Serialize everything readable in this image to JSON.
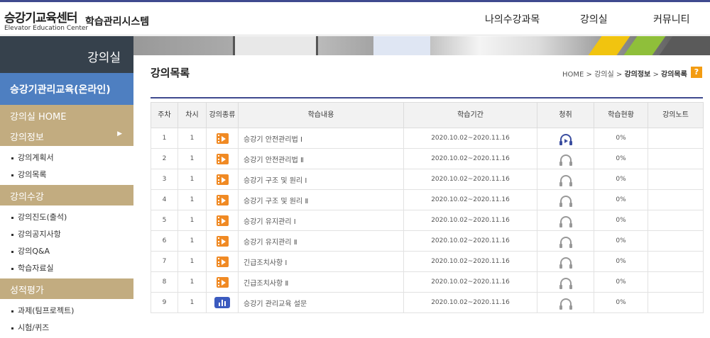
{
  "header": {
    "logo_main": "승강기교육센터",
    "logo_sub": "Elevator Education Center",
    "system_title": "학습관리시스템",
    "nav": [
      "나의수강과목",
      "강의실",
      "커뮤니티"
    ]
  },
  "sidebar": {
    "title": "강의실",
    "course": "승강기관리교육(온라인)",
    "home": "강의실 HOME",
    "sections": [
      {
        "label": "강의정보",
        "items": [
          "강의계획서",
          "강의목록"
        ]
      },
      {
        "label": "강의수강",
        "items": [
          "강의진도(출석)",
          "강의공지사항",
          "강의Q&A",
          "학습자료실"
        ]
      },
      {
        "label": "성적평가",
        "items": [
          "과제(팀프로젝트)",
          "시험/퀴즈"
        ]
      }
    ]
  },
  "page": {
    "title": "강의목록",
    "breadcrumb": [
      "HOME",
      "강의실",
      "강의정보",
      "강의목록"
    ],
    "help_label": "?"
  },
  "table": {
    "headers": [
      "주차",
      "차시",
      "강의종류",
      "학습내용",
      "학습기간",
      "청취",
      "학습현황",
      "강의노트"
    ],
    "rows": [
      {
        "week": "1",
        "session": "1",
        "type": "video-icon",
        "title": "승강기 안전관리법 Ⅰ",
        "period": "2020.10.02~2020.11.16",
        "listen": "active",
        "progress": "0%",
        "note": ""
      },
      {
        "week": "2",
        "session": "1",
        "type": "video-icon",
        "title": "승강기 안전관리법 Ⅱ",
        "period": "2020.10.02~2020.11.16",
        "listen": "inactive",
        "progress": "0%",
        "note": ""
      },
      {
        "week": "3",
        "session": "1",
        "type": "video-icon",
        "title": "승강기 구조 및 원리 Ⅰ",
        "period": "2020.10.02~2020.11.16",
        "listen": "inactive",
        "progress": "0%",
        "note": ""
      },
      {
        "week": "4",
        "session": "1",
        "type": "video-icon",
        "title": "승강기 구조 및 원리 Ⅱ",
        "period": "2020.10.02~2020.11.16",
        "listen": "inactive",
        "progress": "0%",
        "note": ""
      },
      {
        "week": "5",
        "session": "1",
        "type": "video-icon",
        "title": "승강기 유지관리 Ⅰ",
        "period": "2020.10.02~2020.11.16",
        "listen": "inactive",
        "progress": "0%",
        "note": ""
      },
      {
        "week": "6",
        "session": "1",
        "type": "video-icon",
        "title": "승강기 유지관리 Ⅱ",
        "period": "2020.10.02~2020.11.16",
        "listen": "inactive",
        "progress": "0%",
        "note": ""
      },
      {
        "week": "7",
        "session": "1",
        "type": "video-icon",
        "title": "긴급조치사항 Ⅰ",
        "period": "2020.10.02~2020.11.16",
        "listen": "inactive",
        "progress": "0%",
        "note": ""
      },
      {
        "week": "8",
        "session": "1",
        "type": "video-icon",
        "title": "긴급조치사항 Ⅱ",
        "period": "2020.10.02~2020.11.16",
        "listen": "inactive",
        "progress": "0%",
        "note": ""
      },
      {
        "week": "9",
        "session": "1",
        "type": "survey-icon",
        "title": "승강기 관리교육 설문",
        "period": "2020.10.02~2020.11.16",
        "listen": "inactive",
        "progress": "0%",
        "note": ""
      }
    ]
  },
  "colors": {
    "accent": "#3f4a8f",
    "sidebar_dark": "#36414c",
    "sidebar_course": "#4e7fc1",
    "sidebar_section": "#c2ac80",
    "video_icon": "#f08a24",
    "survey_icon": "#3b5bbf"
  }
}
